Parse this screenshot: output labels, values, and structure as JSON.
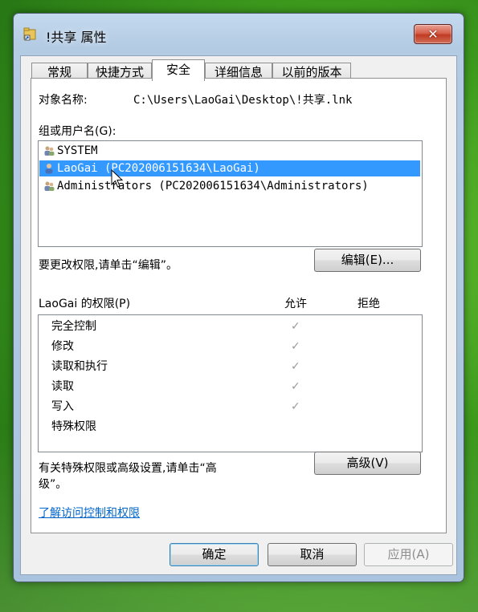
{
  "window": {
    "title": "!共享 属性",
    "close_label": "✕"
  },
  "tabs": [
    {
      "label": "常规"
    },
    {
      "label": "快捷方式"
    },
    {
      "label": "安全",
      "active": true
    },
    {
      "label": "详细信息"
    },
    {
      "label": "以前的版本"
    }
  ],
  "security": {
    "object_label": "对象名称:",
    "object_value": "C:\\Users\\LaoGai\\Desktop\\!共享.lnk",
    "groups_label": "组或用户名(G):",
    "groups": [
      {
        "name": "SYSTEM",
        "icon": "users-group-icon",
        "selected": false
      },
      {
        "name": "LaoGai (PC202006151634\\LaoGai)",
        "icon": "user-icon",
        "selected": true
      },
      {
        "name": "Administrators (PC202006151634\\Administrators)",
        "icon": "users-group-icon",
        "selected": false
      }
    ],
    "change_hint": "要更改权限,请单击“编辑”。",
    "edit_button": "编辑(E)...",
    "permissions_label": "LaoGai 的权限(P)",
    "allow_header": "允许",
    "deny_header": "拒绝",
    "permissions": [
      {
        "name": "完全控制",
        "allow": true,
        "deny": false
      },
      {
        "name": "修改",
        "allow": true,
        "deny": false
      },
      {
        "name": "读取和执行",
        "allow": true,
        "deny": false
      },
      {
        "name": "读取",
        "allow": true,
        "deny": false
      },
      {
        "name": "写入",
        "allow": true,
        "deny": false
      },
      {
        "name": "特殊权限",
        "allow": false,
        "deny": false
      }
    ],
    "check_glyph": "✓",
    "advanced_hint_line1": "有关特殊权限或高级设置,请单击“高",
    "advanced_hint_line2": "级”。",
    "advanced_button": "高级(V)",
    "help_link": "了解访问控制和权限"
  },
  "footer": {
    "ok": "确定",
    "cancel": "取消",
    "apply": "应用(A)"
  },
  "colors": {
    "selection": "#3399ff",
    "link": "#0066cc",
    "close_button": "#c13b22"
  }
}
